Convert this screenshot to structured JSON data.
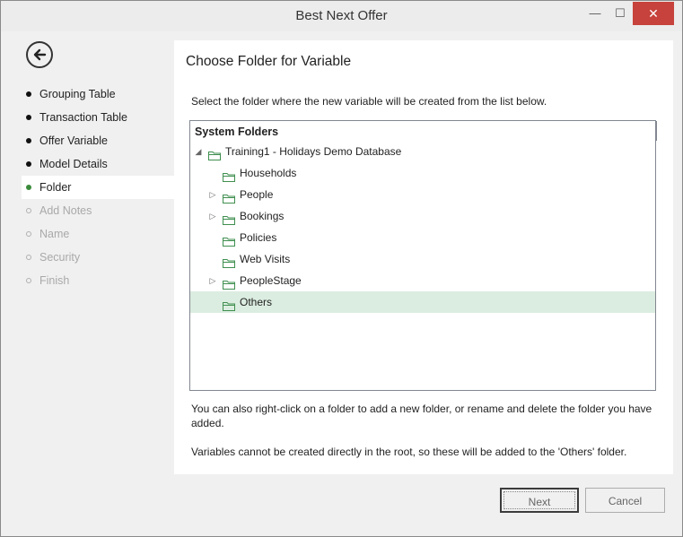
{
  "window": {
    "title": "Best Next Offer"
  },
  "titlebar": {
    "minimize": "—",
    "maximize": "☐",
    "close": "✕"
  },
  "steps": [
    {
      "label": "Grouping Table",
      "state": "done"
    },
    {
      "label": "Transaction Table",
      "state": "done"
    },
    {
      "label": "Offer Variable",
      "state": "done"
    },
    {
      "label": "Model Details",
      "state": "done"
    },
    {
      "label": "Folder",
      "state": "active"
    },
    {
      "label": "Add Notes",
      "state": "disabled"
    },
    {
      "label": "Name",
      "state": "disabled"
    },
    {
      "label": "Security",
      "state": "disabled"
    },
    {
      "label": "Finish",
      "state": "disabled"
    }
  ],
  "content": {
    "heading": "Choose Folder for Variable",
    "instruction": "Select the folder where the new variable will be created from the list below.",
    "tree": {
      "header": "System Folders",
      "nodes": [
        {
          "label": "Training1 - Holidays Demo Database",
          "expander": "◢",
          "expanded": true,
          "selected": false
        },
        {
          "label": "Households",
          "expander": "",
          "selected": false
        },
        {
          "label": "People",
          "expander": "▷",
          "selected": false
        },
        {
          "label": "Bookings",
          "expander": "▷",
          "selected": false
        },
        {
          "label": "Policies",
          "expander": "",
          "selected": false
        },
        {
          "label": "Web Visits",
          "expander": "",
          "selected": false
        },
        {
          "label": "PeopleStage",
          "expander": "▷",
          "selected": false
        },
        {
          "label": "Others",
          "expander": "",
          "selected": true
        }
      ]
    },
    "note1": "You can also right-click on a folder to add a new folder, or rename and delete the folder you have added.",
    "note2": "Variables cannot be created directly in the root, so these will be added to the 'Others' folder."
  },
  "buttons": {
    "next": "Next",
    "cancel": "Cancel"
  },
  "colors": {
    "close_red": "#c7423c",
    "active_green": "#3a8a3a",
    "selection": "#dbede0",
    "folder_green": "#3f8f4f"
  }
}
